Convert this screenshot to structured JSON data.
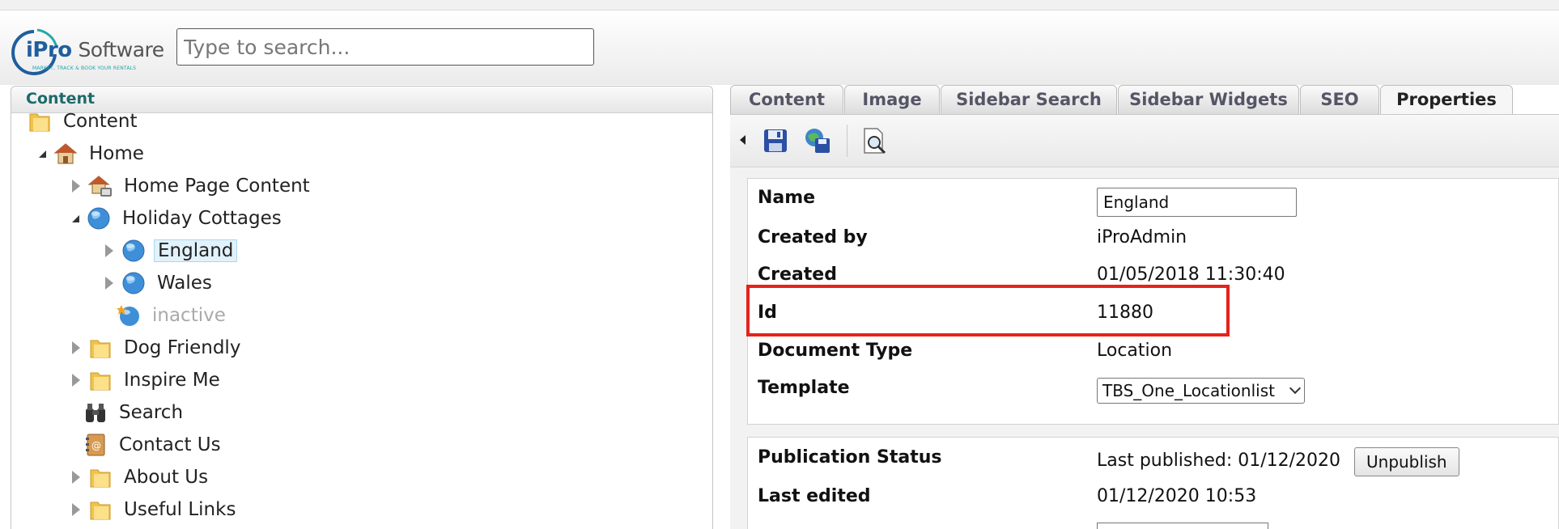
{
  "header": {
    "logo": {
      "brand_i": "i",
      "brand_pro": "Pro",
      "brand_software": "Software",
      "tagline": "MARKET, TRACK & BOOK YOUR RENTALS"
    },
    "search": {
      "placeholder": "Type to search..."
    }
  },
  "tree": {
    "panel_title": "Content",
    "nodes": [
      {
        "label": "Content",
        "icon": "folder-icon",
        "expander": "none"
      },
      {
        "label": "Home",
        "icon": "home-icon",
        "expander": "open"
      },
      {
        "label": "Home Page Content",
        "icon": "home-content-icon",
        "expander": "closed"
      },
      {
        "label": "Holiday Cottages",
        "icon": "globe-icon",
        "expander": "open"
      },
      {
        "label": "England",
        "icon": "globe-icon",
        "expander": "closed",
        "selected": true
      },
      {
        "label": "Wales",
        "icon": "globe-icon",
        "expander": "closed"
      },
      {
        "label": "inactive",
        "icon": "globe-new-icon",
        "expander": "none",
        "muted": true
      },
      {
        "label": "Dog Friendly",
        "icon": "folder-icon",
        "expander": "closed"
      },
      {
        "label": "Inspire Me",
        "icon": "folder-icon",
        "expander": "closed"
      },
      {
        "label": "Search",
        "icon": "binoculars-icon",
        "expander": "none"
      },
      {
        "label": "Contact Us",
        "icon": "address-book-icon",
        "expander": "none"
      },
      {
        "label": "About Us",
        "icon": "folder-icon",
        "expander": "closed"
      },
      {
        "label": "Useful Links",
        "icon": "folder-icon",
        "expander": "closed"
      }
    ]
  },
  "tabs": [
    "Content",
    "Image",
    "Sidebar Search",
    "Sidebar Widgets",
    "SEO",
    "Properties"
  ],
  "active_tab": "Properties",
  "toolbar": {
    "icons": [
      "collapse-arrow-icon",
      "save-icon",
      "save-publish-icon",
      "preview-icon"
    ]
  },
  "properties": {
    "name_label": "Name",
    "name_value": "England",
    "created_by_label": "Created by",
    "created_by_value": "iProAdmin",
    "created_label": "Created",
    "created_value": "01/05/2018 11:30:40",
    "id_label": "Id",
    "id_value": "11880",
    "doc_type_label": "Document Type",
    "doc_type_value": "Location",
    "template_label": "Template",
    "template_value": "TBS_One_Locationlist"
  },
  "publication": {
    "status_label": "Publication Status",
    "last_published": "Last published: 01/12/2020",
    "unpublish_label": "Unpublish",
    "last_edited_label": "Last edited",
    "last_edited_value": "01/12/2020 10:53"
  },
  "colors": {
    "highlight": "#e4231b",
    "brand": "#1f5e9e",
    "tree_header": "#1e6a6a",
    "selected_bg": "#e1f2fb"
  }
}
